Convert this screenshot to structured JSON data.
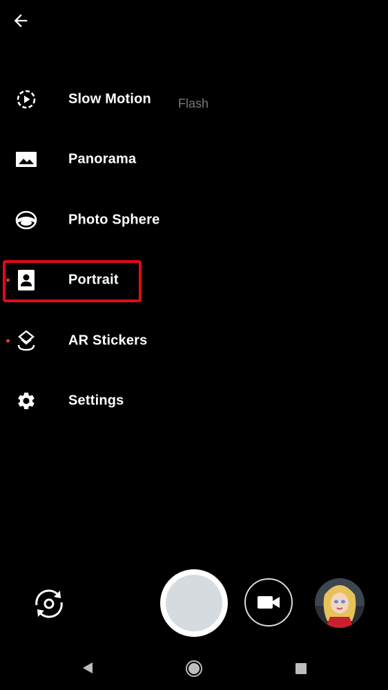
{
  "header": {
    "back_icon": "arrow-left-icon"
  },
  "overlay": {
    "flash_label": "Flash"
  },
  "menu": {
    "items": [
      {
        "label": "Slow Motion",
        "icon": "slow-motion-icon",
        "dot": false
      },
      {
        "label": "Panorama",
        "icon": "panorama-icon",
        "dot": false
      },
      {
        "label": "Photo Sphere",
        "icon": "photo-sphere-icon",
        "dot": false
      },
      {
        "label": "Portrait",
        "icon": "portrait-icon",
        "dot": true,
        "highlighted": true
      },
      {
        "label": "AR Stickers",
        "icon": "ar-stickers-icon",
        "dot": true
      },
      {
        "label": "Settings",
        "icon": "gear-icon",
        "dot": false
      }
    ],
    "highlight_color": "#e50914",
    "dot_color": "#e53935"
  },
  "controls": {
    "switch_camera_icon": "switch-camera-icon",
    "shutter_icon": "shutter-icon",
    "video_icon": "video-camera-icon",
    "gallery_thumbnail": "gallery-thumbnail"
  },
  "navbar": {
    "back_icon": "nav-back-icon",
    "home_icon": "nav-home-icon",
    "recents_icon": "nav-recents-icon"
  }
}
